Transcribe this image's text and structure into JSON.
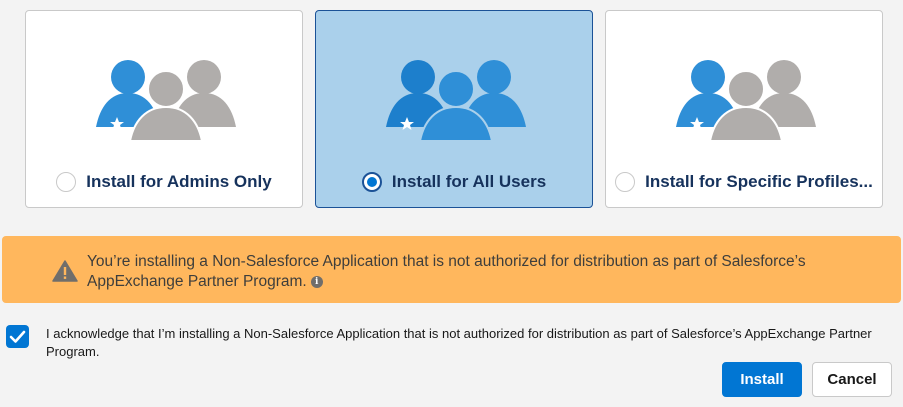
{
  "install_options": [
    {
      "label": "Install for Admins Only",
      "selected": false,
      "people_colors": [
        "#2f8fd7",
        "#b0adab",
        "#b0adab"
      ]
    },
    {
      "label": "Install for All Users",
      "selected": true,
      "people_colors": [
        "#1d7fcc",
        "#2f8fd7",
        "#2f8fd7"
      ]
    },
    {
      "label": "Install for Specific Profiles...",
      "selected": false,
      "people_colors": [
        "#2f8fd7",
        "#b0adab",
        "#b0adab"
      ]
    }
  ],
  "warning": {
    "text": "You’re installing a Non-Salesforce Application that is not authorized for distribution as part of Salesforce’s AppExchange Partner Program.",
    "icon": "warning-icon",
    "info_icon": "info-icon",
    "background": "#ffb75d"
  },
  "acknowledge": {
    "checked": true,
    "text": "I acknowledge that I’m installing a Non-Salesforce Application that is not authorized for distribution as part of Salesforce’s AppExchange Partner Program."
  },
  "buttons": {
    "install_label": "Install",
    "cancel_label": "Cancel"
  },
  "colors": {
    "brand": "#0176d3",
    "selected_card": "#aad0eb",
    "label_text": "#16325c"
  }
}
